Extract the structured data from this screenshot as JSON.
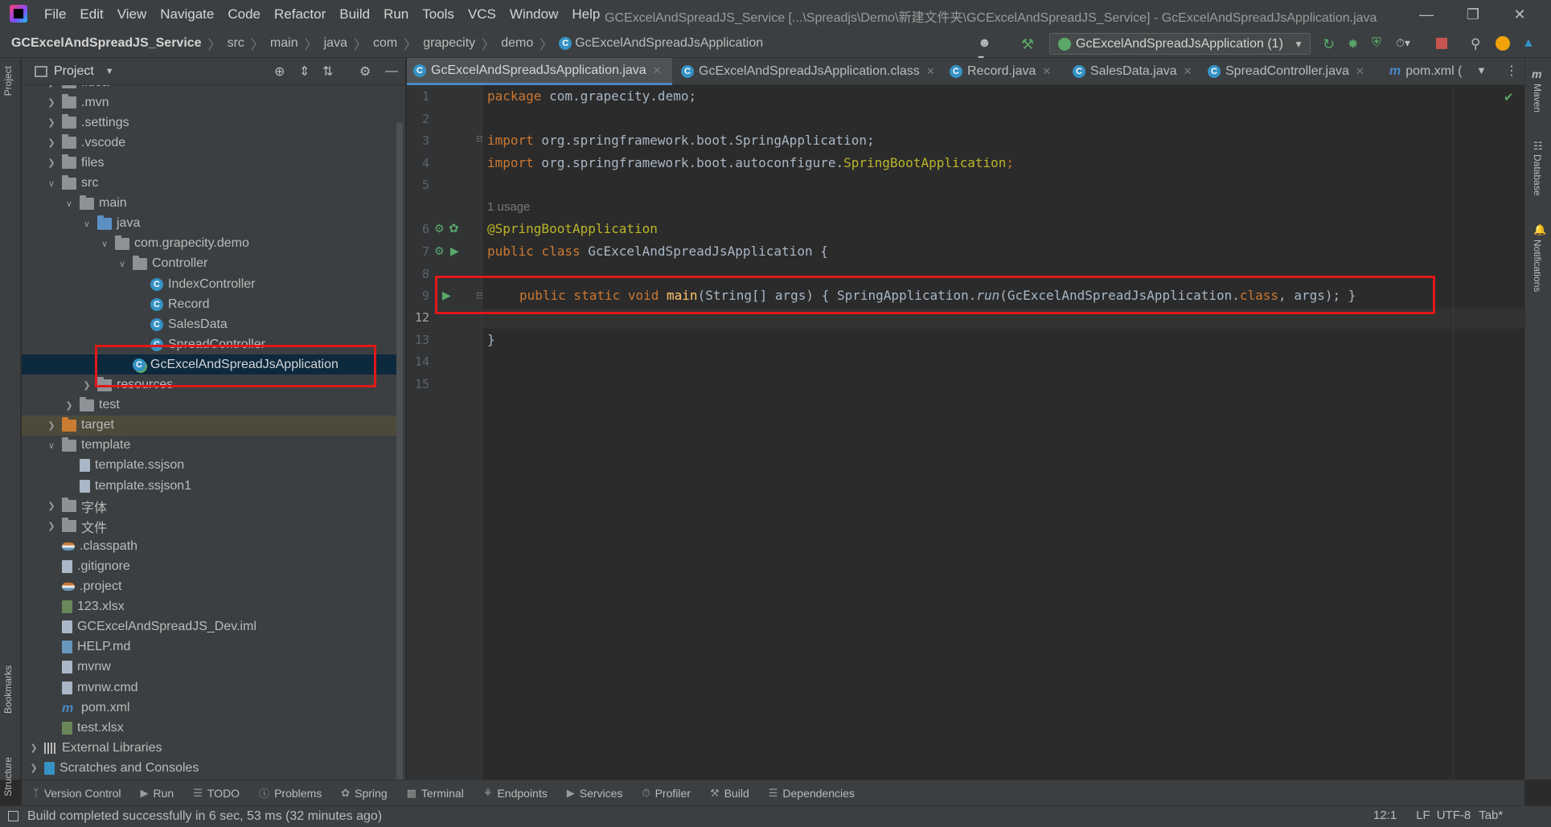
{
  "menubar": {
    "items": [
      "File",
      "Edit",
      "View",
      "Navigate",
      "Code",
      "Refactor",
      "Build",
      "Run",
      "Tools",
      "VCS",
      "Window",
      "Help"
    ],
    "window_title": "GCExcelAndSpreadJS_Service [...\\Spreadjs\\Demo\\新建文件夹\\GCExcelAndSpreadJS_Service] - GcExcelAndSpreadJsApplication.java"
  },
  "navbar": {
    "breadcrumb": [
      "GCExcelAndSpreadJS_Service",
      "src",
      "main",
      "java",
      "com",
      "grapecity",
      "demo",
      "GcExcelAndSpreadJsApplication"
    ],
    "run_config": "GcExcelAndSpreadJsApplication (1)"
  },
  "left_stripe": {
    "project": "Project",
    "bookmarks": "Bookmarks",
    "structure": "Structure"
  },
  "right_stripe": {
    "maven": "Maven",
    "database": "Database",
    "notifications": "Notifications"
  },
  "project_panel": {
    "title": "Project",
    "tree": [
      {
        "label": ".idea",
        "depth": 1,
        "chevron": "right",
        "icon": "folder"
      },
      {
        "label": ".mvn",
        "depth": 1,
        "chevron": "right",
        "icon": "folder"
      },
      {
        "label": ".settings",
        "depth": 1,
        "chevron": "right",
        "icon": "folder"
      },
      {
        "label": ".vscode",
        "depth": 1,
        "chevron": "right",
        "icon": "folder"
      },
      {
        "label": "files",
        "depth": 1,
        "chevron": "right",
        "icon": "folder"
      },
      {
        "label": "src",
        "depth": 1,
        "chevron": "down",
        "icon": "folder"
      },
      {
        "label": "main",
        "depth": 2,
        "chevron": "down",
        "icon": "folder"
      },
      {
        "label": "java",
        "depth": 3,
        "chevron": "down",
        "icon": "folder-blue"
      },
      {
        "label": "com.grapecity.demo",
        "depth": 4,
        "chevron": "down",
        "icon": "package"
      },
      {
        "label": "Controller",
        "depth": 5,
        "chevron": "down",
        "icon": "package"
      },
      {
        "label": "IndexController",
        "depth": 6,
        "chevron": "",
        "icon": "class"
      },
      {
        "label": "Record",
        "depth": 6,
        "chevron": "",
        "icon": "class"
      },
      {
        "label": "SalesData",
        "depth": 6,
        "chevron": "",
        "icon": "class"
      },
      {
        "label": "SpreadController",
        "depth": 6,
        "chevron": "",
        "icon": "class"
      },
      {
        "label": "GcExcelAndSpreadJsApplication",
        "depth": 5,
        "chevron": "",
        "icon": "class-run",
        "selected": true
      },
      {
        "label": "resources",
        "depth": 3,
        "chevron": "right",
        "icon": "folder"
      },
      {
        "label": "test",
        "depth": 2,
        "chevron": "right",
        "icon": "folder"
      },
      {
        "label": "target",
        "depth": 1,
        "chevron": "right",
        "icon": "folder-orange"
      },
      {
        "label": "template",
        "depth": 1,
        "chevron": "down",
        "icon": "folder"
      },
      {
        "label": "template.ssjson",
        "depth": 2,
        "chevron": "",
        "icon": "file"
      },
      {
        "label": "template.ssjson1",
        "depth": 2,
        "chevron": "",
        "icon": "file"
      },
      {
        "label": "字体",
        "depth": 1,
        "chevron": "right",
        "icon": "folder"
      },
      {
        "label": "文件",
        "depth": 1,
        "chevron": "right",
        "icon": "folder"
      },
      {
        "label": ".classpath",
        "depth": 1,
        "chevron": "",
        "icon": "proj"
      },
      {
        "label": ".gitignore",
        "depth": 1,
        "chevron": "",
        "icon": "file"
      },
      {
        "label": ".project",
        "depth": 1,
        "chevron": "",
        "icon": "proj"
      },
      {
        "label": "123.xlsx",
        "depth": 1,
        "chevron": "",
        "icon": "xl"
      },
      {
        "label": "GCExcelAndSpreadJS_Dev.iml",
        "depth": 1,
        "chevron": "",
        "icon": "file"
      },
      {
        "label": "HELP.md",
        "depth": 1,
        "chevron": "",
        "icon": "md"
      },
      {
        "label": "mvnw",
        "depth": 1,
        "chevron": "",
        "icon": "file"
      },
      {
        "label": "mvnw.cmd",
        "depth": 1,
        "chevron": "",
        "icon": "file"
      },
      {
        "label": "pom.xml",
        "depth": 1,
        "chevron": "",
        "icon": "maven"
      },
      {
        "label": "test.xlsx",
        "depth": 1,
        "chevron": "",
        "icon": "xl"
      },
      {
        "label": "External Libraries",
        "depth": 0,
        "chevron": "right",
        "icon": "lib"
      },
      {
        "label": "Scratches and Consoles",
        "depth": 0,
        "chevron": "right",
        "icon": "scratch"
      }
    ]
  },
  "editor": {
    "tabs": [
      {
        "label": "GcExcelAndSpreadJsApplication.java",
        "active": true
      },
      {
        "label": "GcExcelAndSpreadJsApplication.class",
        "active": false
      },
      {
        "label": "Record.java",
        "active": false
      },
      {
        "label": "SalesData.java",
        "active": false
      },
      {
        "label": "SpreadController.java",
        "active": false
      },
      {
        "label": "pom.xml (",
        "active": false
      }
    ],
    "line_numbers": [
      "1",
      "2",
      "3",
      "4",
      "5",
      "6",
      "7",
      "8",
      "9",
      "12",
      "13",
      "14",
      "15"
    ],
    "usage_hint": "1 usage",
    "code": {
      "l1_kw": "package",
      "l1_rest": " com.grapecity.demo;",
      "l3_kw": "import",
      "l3_rest": " org.springframework.boot.SpringApplication;",
      "l4_kw": "import",
      "l4_rest": " org.springframework.boot.autoconfigure.",
      "l4_ann": "SpringBootApplication",
      "l4_end": ";",
      "l6_ann": "@SpringBootApplication",
      "l7_kw": "public class",
      "l7_rest": " GcExcelAndSpreadJsApplication {",
      "l9_kw": "public static void",
      "l9_fn": " main",
      "l9_a": "(String[] args) { SpringApplication.",
      "l9_run": "run",
      "l9_b": "(GcExcelAndSpreadJsApplication.",
      "l9_class": "class",
      "l9_c": ", args); }",
      "l13": "}"
    }
  },
  "bottom_tools": [
    "Version Control",
    "Run",
    "TODO",
    "Problems",
    "Spring",
    "Terminal",
    "Endpoints",
    "Services",
    "Profiler",
    "Build",
    "Dependencies"
  ],
  "status": {
    "message": "Build completed successfully in 6 sec, 53 ms (32 minutes ago)",
    "position": "12:1",
    "line_sep": "LF",
    "encoding": "UTF-8",
    "indent": "Tab*"
  },
  "colors": {
    "accent": "#4a88c7",
    "highlight_box": "#e01919"
  }
}
